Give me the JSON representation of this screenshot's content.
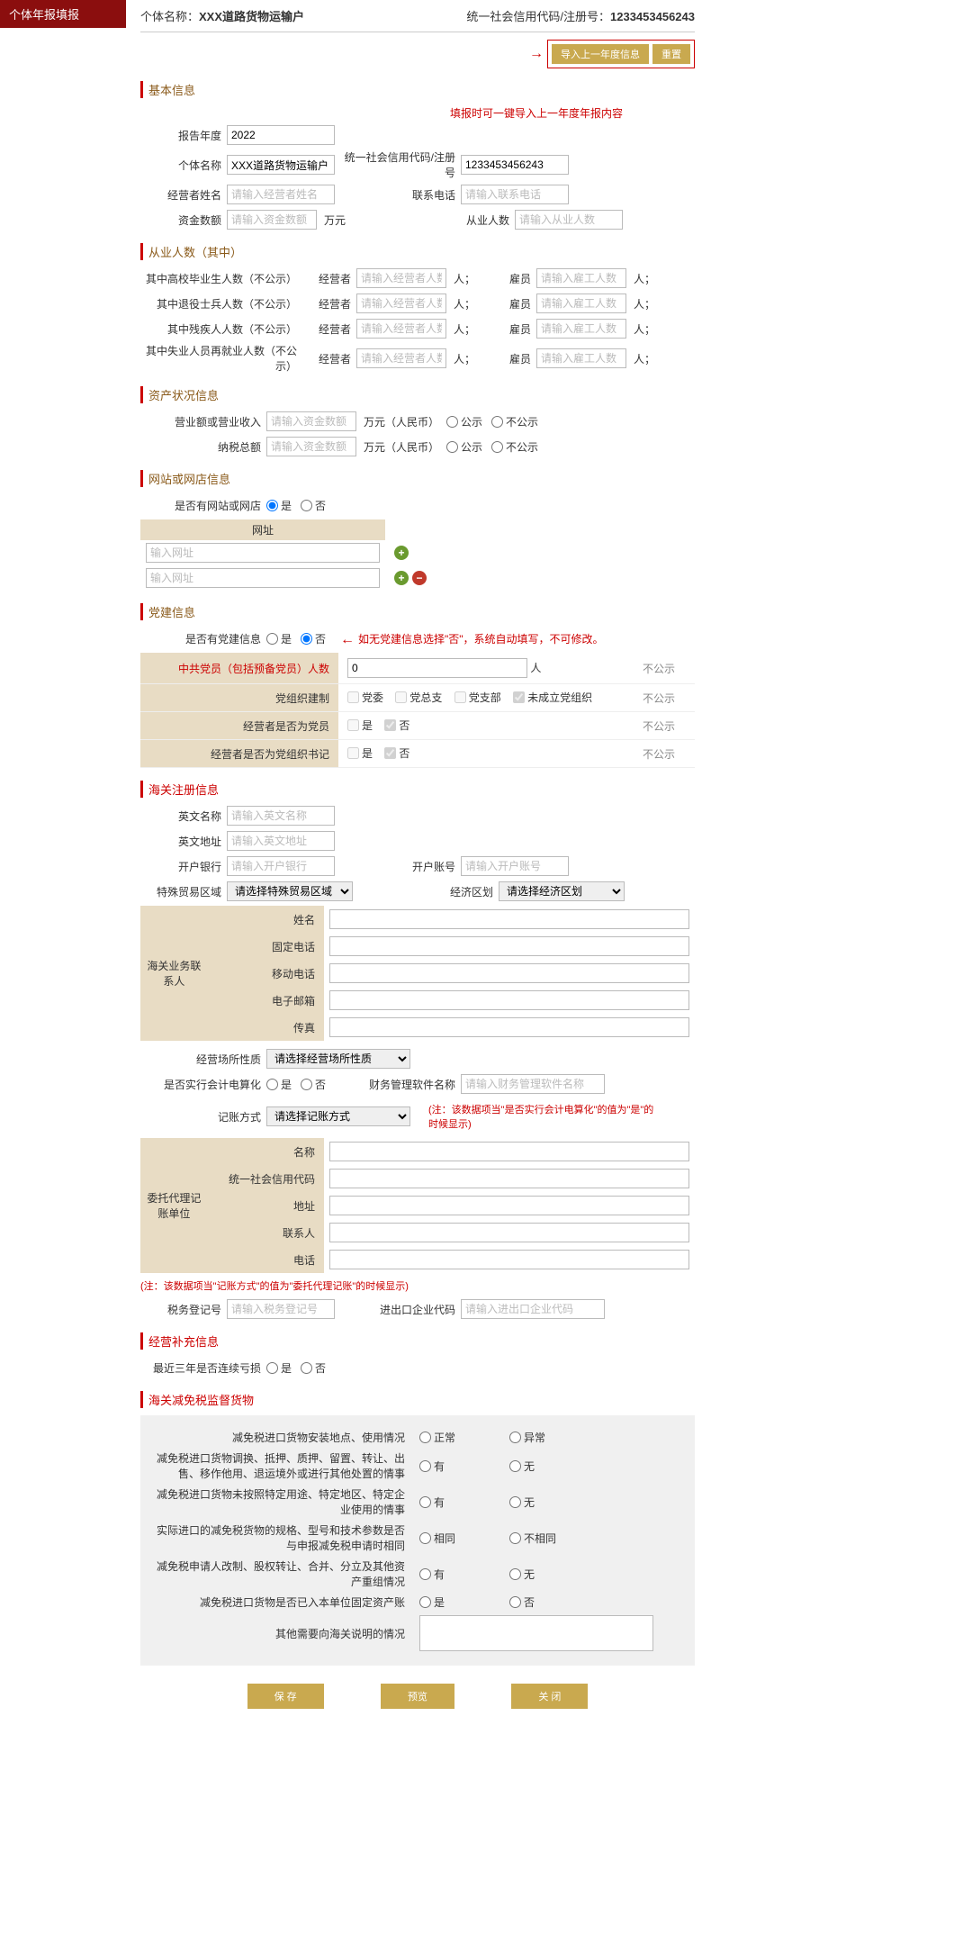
{
  "sidebar": {
    "title": "个体年报填报"
  },
  "header": {
    "entity_label": "个体名称：",
    "entity_name": "XXX道路货物运输户",
    "code_label": "统一社会信用代码/注册号：",
    "code_value": "1233453456243"
  },
  "topbtn": {
    "import": "导入上一年度信息",
    "reset": "重置"
  },
  "notes": {
    "top_tip": "填报时可一键导入上一年度年报内容",
    "dj_tip": "如无党建信息选择\"否\"，系统自动填写，不可修改。",
    "fin_soft_tip": "(注：该数据项当\"是否实行会计电算化\"的值为\"是\"的时候显示)",
    "agent_tip": "(注：该数据项当\"记账方式\"的值为\"委托代理记账\"的时候显示)"
  },
  "sections": {
    "basic": "基本信息",
    "employ": "从业人数（其中）",
    "asset": "资产状况信息",
    "site": "网站或网店信息",
    "dj": "党建信息",
    "customs": "海关注册信息",
    "extra": "经营补充信息",
    "supervise": "海关减免税监督货物"
  },
  "basic": {
    "year_label": "报告年度",
    "year_value": "2022",
    "name_label": "个体名称",
    "name_value": "XXX道路货物运输户",
    "code_label": "统一社会信用代码/注册号",
    "code_value": "1233453456243",
    "operator_label": "经营者姓名",
    "operator_ph": "请输入经营者姓名",
    "phone_label": "联系电话",
    "phone_ph": "请输入联系电话",
    "capital_label": "资金数额",
    "capital_ph": "请输入资金数额",
    "capital_unit": "万元",
    "emp_label": "从业人数",
    "emp_ph": "请输入从业人数"
  },
  "employ": {
    "rows": [
      {
        "label": "其中高校毕业生人数（不公示）"
      },
      {
        "label": "其中退役士兵人数（不公示）"
      },
      {
        "label": "其中残疾人人数（不公示）"
      },
      {
        "label": "其中失业人员再就业人数（不公示）"
      }
    ],
    "op_label": "经营者",
    "op_ph": "请输入经营者人数",
    "op_unit": "人；",
    "hire_label": "雇员",
    "hire_ph": "请输入雇工人数",
    "hire_unit": "人；"
  },
  "asset": {
    "rev_label": "营业额或营业收入",
    "rev_ph": "请输入资金数额",
    "tax_label": "纳税总额",
    "tax_ph": "请输入资金数额",
    "unit": "万元（人民币）",
    "pub_yes": "公示",
    "pub_no": "不公示"
  },
  "site": {
    "has_label": "是否有网站或网店",
    "yes": "是",
    "no": "否",
    "url_header": "网址",
    "url_ph": "输入网址"
  },
  "dj": {
    "has_label": "是否有党建信息",
    "yes": "是",
    "no": "否",
    "rows": {
      "member_count": "中共党员（包括预备党员）人数",
      "member_value": "0",
      "member_unit": "人",
      "org_type": "党组织建制",
      "org_opts": [
        "党委",
        "党总支",
        "党支部",
        "未成立党组织"
      ],
      "is_member": "经营者是否为党员",
      "is_secretary": "经营者是否为党组织书记",
      "pub_no": "不公示",
      "yn_yes": "是",
      "yn_no": "否"
    }
  },
  "customs": {
    "en_name_label": "英文名称",
    "en_name_ph": "请输入英文名称",
    "en_addr_label": "英文地址",
    "en_addr_ph": "请输入英文地址",
    "bank_label": "开户银行",
    "bank_ph": "请输入开户银行",
    "acct_label": "开户账号",
    "acct_ph": "请输入开户账号",
    "trade_zone_label": "特殊贸易区域",
    "trade_zone_opt": "请选择特殊贸易区域",
    "eco_zone_label": "经济区划",
    "eco_zone_opt": "请选择经济区划",
    "contact_side": "海关业务联系人",
    "contact_rows": [
      "姓名",
      "固定电话",
      "移动电话",
      "电子邮箱",
      "传真"
    ],
    "place_label": "经营场所性质",
    "place_opt": "请选择经营场所性质",
    "elec_label": "是否实行会计电算化",
    "soft_label": "财务管理软件名称",
    "soft_ph": "请输入财务管理软件名称",
    "book_label": "记账方式",
    "book_opt": "请选择记账方式",
    "agent_side": "委托代理记账单位",
    "agent_rows": [
      "名称",
      "统一社会信用代码",
      "地址",
      "联系人",
      "电话"
    ],
    "tax_reg_label": "税务登记号",
    "tax_reg_ph": "请输入税务登记号",
    "ie_code_label": "进出口企业代码",
    "ie_code_ph": "请输入进出口企业代码"
  },
  "extra": {
    "loss_label": "最近三年是否连续亏损",
    "yes": "是",
    "no": "否"
  },
  "supervise": {
    "rows": [
      {
        "q": "减免税进口货物安装地点、使用情况",
        "a": "正常",
        "b": "异常"
      },
      {
        "q": "减免税进口货物调换、抵押、质押、留置、转让、出售、移作他用、退运境外或进行其他处置的情事",
        "a": "有",
        "b": "无"
      },
      {
        "q": "减免税进口货物未按照特定用途、特定地区、特定企业使用的情事",
        "a": "有",
        "b": "无"
      },
      {
        "q": "实际进口的减免税货物的规格、型号和技术参数是否与申报减免税申请时相同",
        "a": "相同",
        "b": "不相同"
      },
      {
        "q": "减免税申请人改制、股权转让、合并、分立及其他资产重组情况",
        "a": "有",
        "b": "无"
      },
      {
        "q": "减免税进口货物是否已入本单位固定资产账",
        "a": "是",
        "b": "否"
      }
    ],
    "other_label": "其他需要向海关说明的情况"
  },
  "bottom": {
    "save": "保  存",
    "preview": "预览",
    "close": "关  闭"
  },
  "common": {
    "yes": "是",
    "no": "否"
  }
}
